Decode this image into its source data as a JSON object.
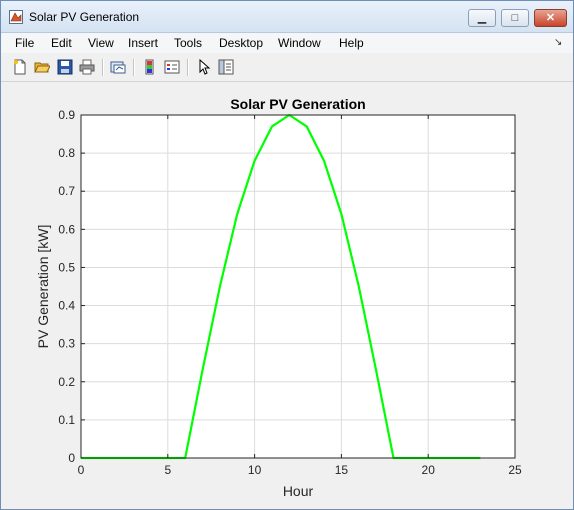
{
  "window": {
    "title": "Solar PV Generation",
    "minimize_glyph": "▁",
    "maximize_glyph": "□",
    "close_glyph": "✕"
  },
  "menu": {
    "items": [
      "File",
      "Edit",
      "View",
      "Insert",
      "Tools",
      "Desktop",
      "Window",
      "Help"
    ],
    "overflow_glyph": "↘"
  },
  "toolbar": {
    "icons": [
      "new-figure-icon",
      "open-file-icon",
      "save-icon",
      "print-icon",
      "link-plot-icon",
      "insert-colorbar-icon",
      "insert-legend-icon",
      "edit-plot-arrow-icon",
      "property-inspector-icon"
    ]
  },
  "chart_data": {
    "type": "line",
    "title": "Solar PV Generation",
    "xlabel": "Hour",
    "ylabel": "PV Generation [kW]",
    "xlim": [
      0,
      25
    ],
    "ylim": [
      0,
      0.9
    ],
    "xticks": [
      0,
      5,
      10,
      15,
      20,
      25
    ],
    "yticks": [
      0,
      0.1,
      0.2,
      0.3,
      0.4,
      0.5,
      0.6,
      0.7,
      0.8,
      0.9
    ],
    "grid": true,
    "color": "#00ff00",
    "series": [
      {
        "x": [
          0,
          1,
          2,
          3,
          4,
          5,
          6,
          7,
          8,
          9,
          10,
          11,
          12,
          13,
          14,
          15,
          16,
          17,
          18,
          19,
          20,
          21,
          22,
          23
        ],
        "values": [
          0,
          0,
          0,
          0,
          0,
          0,
          0,
          0.23,
          0.45,
          0.64,
          0.78,
          0.87,
          0.9,
          0.87,
          0.78,
          0.64,
          0.45,
          0.23,
          0,
          0,
          0,
          0,
          0,
          0
        ]
      }
    ]
  }
}
